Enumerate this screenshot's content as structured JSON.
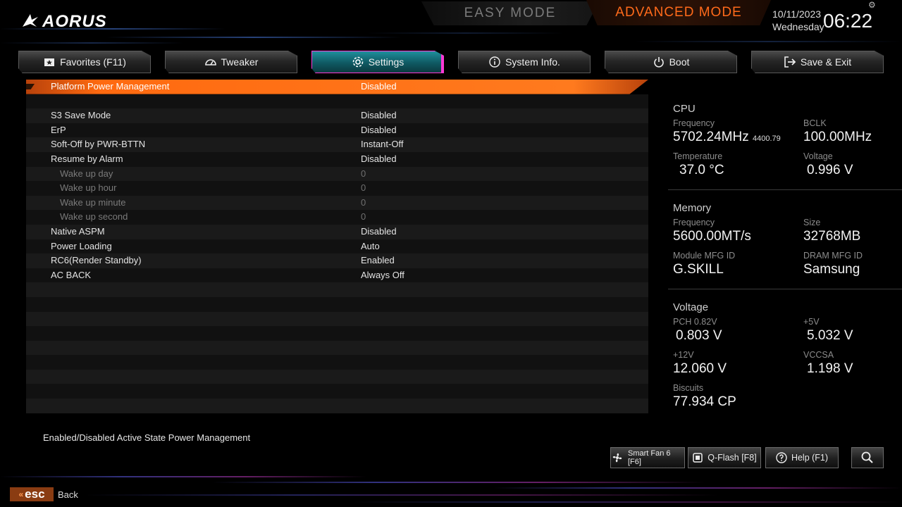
{
  "header": {
    "logo_text": "AORUS",
    "easy_mode_label": "EASY MODE",
    "advanced_mode_label": "ADVANCED MODE",
    "date": "10/11/2023",
    "weekday": "Wednesday",
    "time": "06:22"
  },
  "tabs": [
    {
      "label": "Favorites (F11)",
      "icon": "star-folder-icon",
      "active": false
    },
    {
      "label": "Tweaker",
      "icon": "gauge-icon",
      "active": false
    },
    {
      "label": "Settings",
      "icon": "gear-icon",
      "active": true
    },
    {
      "label": "System Info.",
      "icon": "info-icon",
      "active": false
    },
    {
      "label": "Boot",
      "icon": "power-icon",
      "active": false
    },
    {
      "label": "Save & Exit",
      "icon": "exit-icon",
      "active": false
    }
  ],
  "settings": {
    "rows": [
      {
        "label": "Platform Power Management",
        "value": "Disabled",
        "selected": true,
        "sub": false
      },
      {
        "label": "",
        "value": "",
        "selected": false,
        "sub": false
      },
      {
        "label": "S3 Save Mode",
        "value": "Disabled",
        "selected": false,
        "sub": false
      },
      {
        "label": "ErP",
        "value": "Disabled",
        "selected": false,
        "sub": false
      },
      {
        "label": "Soft-Off by PWR-BTTN",
        "value": "Instant-Off",
        "selected": false,
        "sub": false
      },
      {
        "label": "Resume by Alarm",
        "value": "Disabled",
        "selected": false,
        "sub": false
      },
      {
        "label": "Wake up day",
        "value": "0",
        "selected": false,
        "sub": true
      },
      {
        "label": "Wake up hour",
        "value": "0",
        "selected": false,
        "sub": true
      },
      {
        "label": "Wake up minute",
        "value": "0",
        "selected": false,
        "sub": true
      },
      {
        "label": "Wake up second",
        "value": "0",
        "selected": false,
        "sub": true
      },
      {
        "label": "Native ASPM",
        "value": "Disabled",
        "selected": false,
        "sub": false
      },
      {
        "label": "Power Loading",
        "value": "Auto",
        "selected": false,
        "sub": false
      },
      {
        "label": "RC6(Render Standby)",
        "value": "Enabled",
        "selected": false,
        "sub": false
      },
      {
        "label": "AC BACK",
        "value": "Always Off",
        "selected": false,
        "sub": false
      },
      {
        "label": "",
        "value": "",
        "selected": false,
        "sub": false
      },
      {
        "label": "",
        "value": "",
        "selected": false,
        "sub": false
      },
      {
        "label": "",
        "value": "",
        "selected": false,
        "sub": false
      },
      {
        "label": "",
        "value": "",
        "selected": false,
        "sub": false
      },
      {
        "label": "",
        "value": "",
        "selected": false,
        "sub": false
      },
      {
        "label": "",
        "value": "",
        "selected": false,
        "sub": false
      },
      {
        "label": "",
        "value": "",
        "selected": false,
        "sub": false
      },
      {
        "label": "",
        "value": "",
        "selected": false,
        "sub": false
      },
      {
        "label": "",
        "value": "",
        "selected": false,
        "sub": false
      }
    ]
  },
  "help_text": "Enabled/Disabled Active State Power Management",
  "hardware": {
    "cpu": {
      "title": "CPU",
      "frequency_label": "Frequency",
      "frequency_value": "5702.24MHz",
      "frequency_sub": "4400.79",
      "bclk_label": "BCLK",
      "bclk_value": "100.00MHz",
      "temperature_label": "Temperature",
      "temperature_value": "37.0 °C",
      "voltage_label": "Voltage",
      "voltage_value": "0.996 V"
    },
    "memory": {
      "title": "Memory",
      "frequency_label": "Frequency",
      "frequency_value": "5600.00MT/s",
      "size_label": "Size",
      "size_value": "32768MB",
      "module_mfg_label": "Module MFG ID",
      "module_mfg_value": "G.SKILL",
      "dram_mfg_label": "DRAM MFG ID",
      "dram_mfg_value": "Samsung"
    },
    "voltage": {
      "title": "Voltage",
      "pch_label": "PCH 0.82V",
      "pch_value": "0.803 V",
      "v5_label": "+5V",
      "v5_value": "5.032 V",
      "v12_label": "+12V",
      "v12_value": "12.060 V",
      "vccsa_label": "VCCSA",
      "vccsa_value": "1.198 V",
      "biscuits_label": "Biscuits",
      "biscuits_value": "77.934 CP"
    }
  },
  "footer": {
    "smart_fan_label": "Smart Fan 6 [F6]",
    "qflash_label": "Q-Flash [F8]",
    "help_label": "Help (F1)",
    "esc_label": "esc",
    "back_label": "Back"
  },
  "colors": {
    "accent_orange": "#ff6a10",
    "active_tab_teal": "#1f8f9c",
    "active_tab_border": "#ff39d6"
  }
}
